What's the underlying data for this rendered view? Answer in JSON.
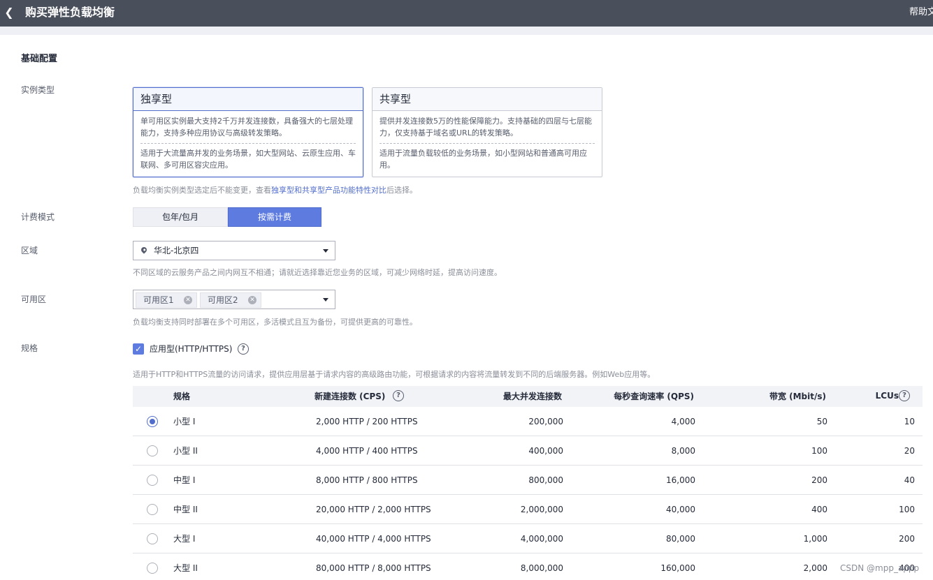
{
  "header": {
    "back_icon": "chevron-left-icon",
    "title": "购买弹性负载均衡",
    "help": "帮助文"
  },
  "section": {
    "title": "基础配置"
  },
  "instance_type": {
    "label": "实例类型",
    "cards": [
      {
        "title": "独享型",
        "desc": "单可用区实例最大支持2千万并发连接数，具备强大的七层处理能力，支持多种应用协议与高级转发策略。",
        "scene": "适用于大流量高并发的业务场景，如大型网站、云原生应用、车联网、多可用区容灾应用。",
        "selected": true
      },
      {
        "title": "共享型",
        "desc": "提供并发连接数5万的性能保障能力。支持基础的四层与七层能力，仅支持基于域名或URL的转发策略。",
        "scene": "适用于流量负载较低的业务场景，如小型网站和普通高可用应用。",
        "selected": false
      }
    ],
    "hint_pre": "负载均衡实例类型选定后不能变更，查看",
    "hint_link": "独享型和共享型产品功能特性对比",
    "hint_post": "后选择。"
  },
  "billing": {
    "label": "计费模式",
    "options": [
      "包年/包月",
      "按需计费"
    ],
    "selected": "按需计费"
  },
  "region": {
    "label": "区域",
    "icon": "location-pin-icon",
    "value": "华北-北京四",
    "hint": "不同区域的云服务产品之间内网互不相通；请就近选择靠近您业务的区域，可减少网络时延，提高访问速度。"
  },
  "az": {
    "label": "可用区",
    "tags": [
      "可用区1",
      "可用区2"
    ],
    "hint": "负载均衡支持同时部署在多个可用区，多活模式且互为备份，可提供更高的可靠性。"
  },
  "spec": {
    "label": "规格",
    "checkbox_label": "应用型(HTTP/HTTPS)",
    "checked": true,
    "desc": "适用于HTTP和HTTPS流量的访问请求，提供应用层基于请求内容的高级路由功能，可根据请求的内容将流量转发到不同的后端服务器。例如Web应用等。",
    "columns": [
      "规格",
      "新建连接数 (CPS)",
      "最大并发连接数",
      "每秒查询速率 (QPS)",
      "带宽 (Mbit/s)",
      "LCUs"
    ],
    "rows": [
      {
        "name": "小型 I",
        "cps": "2,000 HTTP / 200 HTTPS",
        "conn": "200,000",
        "qps": "4,000",
        "bw": "50",
        "lcus": "10",
        "selected": true
      },
      {
        "name": "小型 II",
        "cps": "4,000 HTTP / 400 HTTPS",
        "conn": "400,000",
        "qps": "8,000",
        "bw": "100",
        "lcus": "20",
        "selected": false
      },
      {
        "name": "中型 I",
        "cps": "8,000 HTTP / 800 HTTPS",
        "conn": "800,000",
        "qps": "16,000",
        "bw": "200",
        "lcus": "40",
        "selected": false
      },
      {
        "name": "中型 II",
        "cps": "20,000 HTTP / 2,000 HTTPS",
        "conn": "2,000,000",
        "qps": "40,000",
        "bw": "400",
        "lcus": "100",
        "selected": false
      },
      {
        "name": "大型 I",
        "cps": "40,000 HTTP / 4,000 HTTPS",
        "conn": "4,000,000",
        "qps": "80,000",
        "bw": "1,000",
        "lcus": "200",
        "selected": false
      },
      {
        "name": "大型 II",
        "cps": "80,000 HTTP / 8,000 HTTPS",
        "conn": "8,000,000",
        "qps": "160,000",
        "bw": "2,000",
        "lcus": "400",
        "selected": false
      }
    ]
  },
  "watermark": "CSDN @mpp_appp",
  "colors": {
    "accent": "#5e7ce0",
    "topbar": "#4a4f5c"
  }
}
